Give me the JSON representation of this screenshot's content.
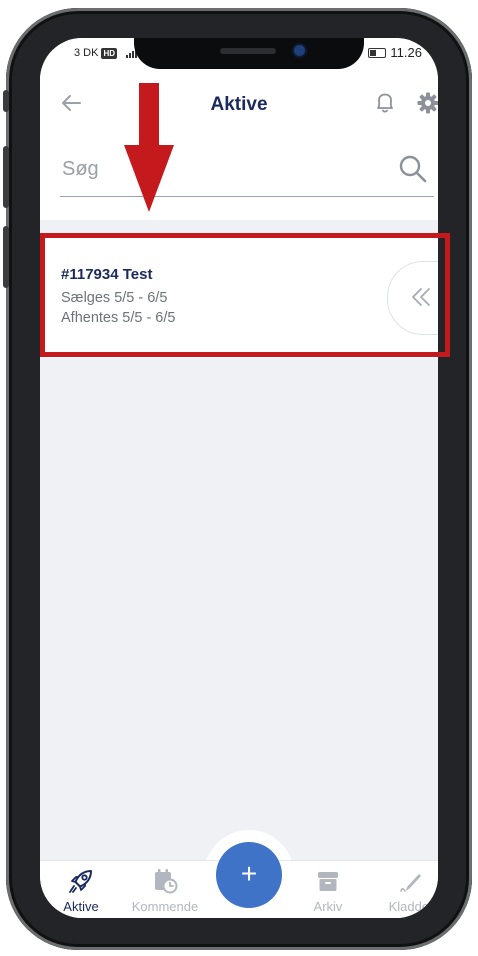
{
  "status_bar": {
    "carrier": "3 DK",
    "network_badge": "HD",
    "time": "11.26"
  },
  "header": {
    "title": "Aktive",
    "back_icon": "back-arrow-icon",
    "bell_icon": "bell-icon",
    "settings_icon": "gear-icon"
  },
  "search": {
    "placeholder": "Søg",
    "icon": "search-icon"
  },
  "list": {
    "items": [
      {
        "title": "#117934 Test",
        "sell_period": "Sælges 5/5 - 6/5",
        "pickup_period": "Afhentes 5/5 - 6/5",
        "swipe_icon": "double-chevron-left-icon"
      }
    ]
  },
  "tabbar": {
    "tabs": [
      {
        "label": "Aktive",
        "icon": "rocket-icon",
        "active": true
      },
      {
        "label": "Kommende",
        "icon": "calendar-clock-icon",
        "active": false
      },
      {
        "label": "Arkiv",
        "icon": "archive-icon",
        "active": false
      },
      {
        "label": "Kladder",
        "icon": "pencil-icon",
        "active": false
      }
    ],
    "add_button": "+"
  },
  "colors": {
    "brand_navy": "#1b2a5e",
    "fab_blue": "#3f73c8",
    "highlight_red": "#c4191d",
    "background": "#eff1f5"
  }
}
